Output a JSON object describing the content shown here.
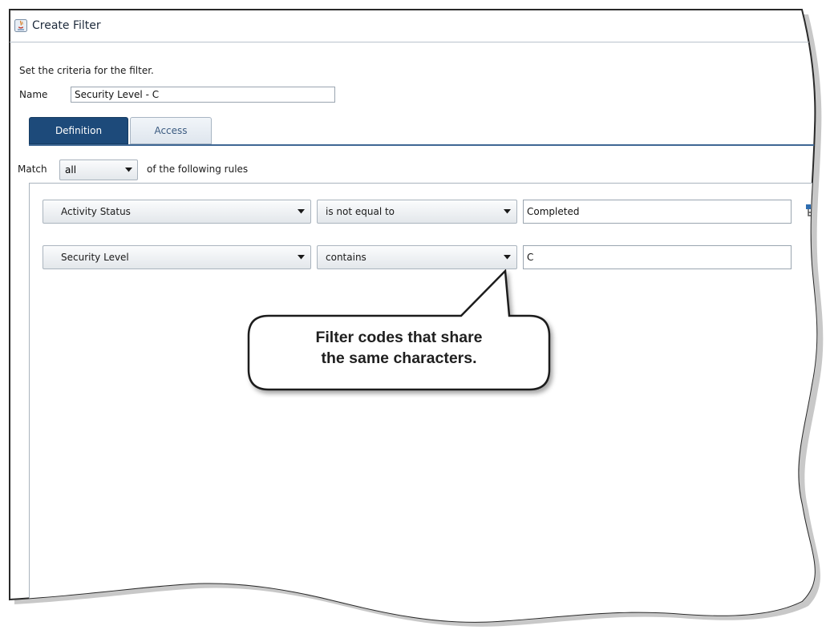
{
  "window": {
    "title": "Create Filter",
    "icon": "java-app-icon"
  },
  "instructions": "Set the criteria for the filter.",
  "name_field": {
    "label": "Name",
    "value": "Security Level - C"
  },
  "tabs": [
    {
      "label": "Definition",
      "active": true
    },
    {
      "label": "Access",
      "active": false
    }
  ],
  "match": {
    "prefix": "Match",
    "selected": "all",
    "suffix": "of the following rules"
  },
  "rules": [
    {
      "field": "Activity Status",
      "operator": "is not equal to",
      "value": "Completed"
    },
    {
      "field": "Security Level",
      "operator": "contains",
      "value": "C"
    }
  ],
  "callout": {
    "lines": [
      "Filter codes that share",
      "the same characters."
    ]
  },
  "colors": {
    "tab_active_bg": "#1d4a7a",
    "tab_active_text": "#ffffff",
    "tab_inactive_text": "#3a5a80",
    "accent_line": "#3e6794"
  }
}
